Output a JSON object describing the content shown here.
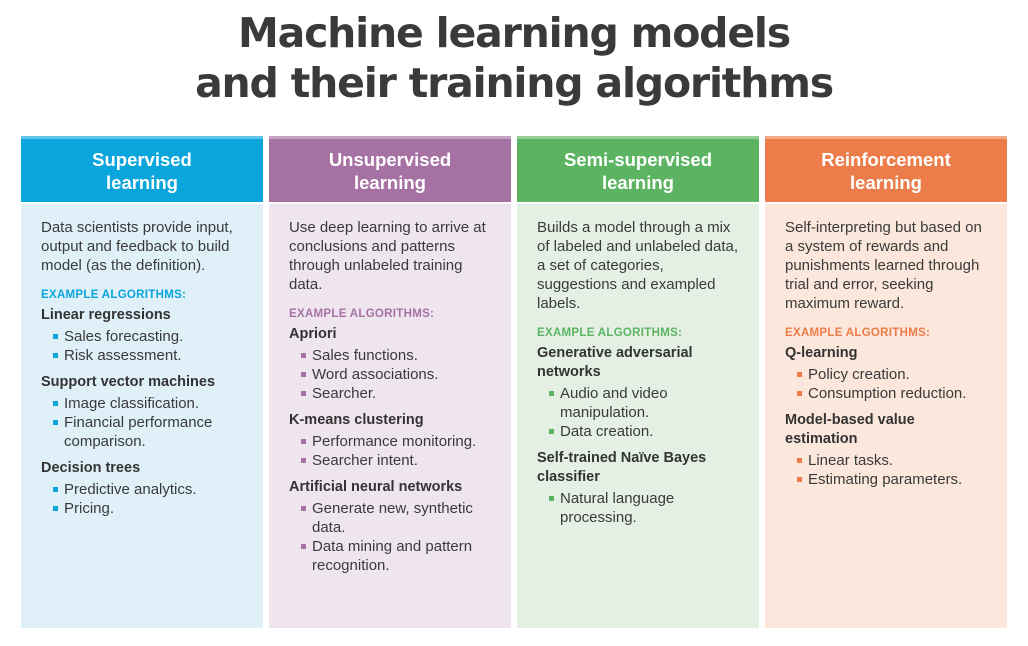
{
  "title": {
    "line1": "Machine learning models",
    "line2": "and their training algorithms"
  },
  "example_label": "EXAMPLE ALGORITHMS:",
  "columns": [
    {
      "header": "Supervised\nlearning",
      "header_color": "#0aa5db",
      "body_color": "#dff0f9",
      "accent_color": "#0aa5db",
      "description": "Data scientists provide input, output and feedback to build model (as the definition).",
      "algorithms": [
        {
          "name": "Linear regressions",
          "items": [
            "Sales forecasting.",
            "Risk assessment."
          ]
        },
        {
          "name": "Support vector machines",
          "items": [
            "Image classification.",
            "Financial performance comparison."
          ]
        },
        {
          "name": "Decision trees",
          "items": [
            "Predictive analytics.",
            "Pricing."
          ]
        }
      ]
    },
    {
      "header": "Unsupervised\nlearning",
      "header_color": "#a672a4",
      "body_color": "#efe5ef",
      "accent_color": "#a672a4",
      "description": "Use deep learning to arrive at conclusions and patterns through unlabeled training data.",
      "algorithms": [
        {
          "name": "Apriori",
          "items": [
            "Sales functions.",
            "Word associations.",
            "Searcher."
          ]
        },
        {
          "name": "K-means clustering",
          "items": [
            "Performance monitoring.",
            "Searcher intent."
          ]
        },
        {
          "name": "Artificial neural networks",
          "items": [
            "Generate new, synthetic data.",
            "Data mining and pattern recognition."
          ]
        }
      ]
    },
    {
      "header": "Semi-supervised\nlearning",
      "header_color": "#5cb463",
      "body_color": "#e5f0e4",
      "accent_color": "#5cb463",
      "description": "Builds a model through a mix of labeled and unlabeled data, a set of categories, suggestions and exampled labels.",
      "algorithms": [
        {
          "name": "Generative adversarial networks",
          "items": [
            "Audio and video manipulation.",
            "Data creation."
          ]
        },
        {
          "name": "Self-trained Naïve Bayes classifier",
          "items": [
            "Natural language processing."
          ]
        }
      ]
    },
    {
      "header": "Reinforcement\nlearning",
      "header_color": "#ec7d4a",
      "body_color": "#fbe7dc",
      "accent_color": "#ec7d4a",
      "description": "Self-interpreting but based on a system of rewards and punishments learned through trial and error, seeking maximum reward.",
      "algorithms": [
        {
          "name": "Q-learning",
          "items": [
            "Policy creation.",
            "Consumption reduction."
          ]
        },
        {
          "name": "Model-based value estimation",
          "items": [
            "Linear tasks.",
            "Estimating parameters."
          ]
        }
      ]
    }
  ]
}
